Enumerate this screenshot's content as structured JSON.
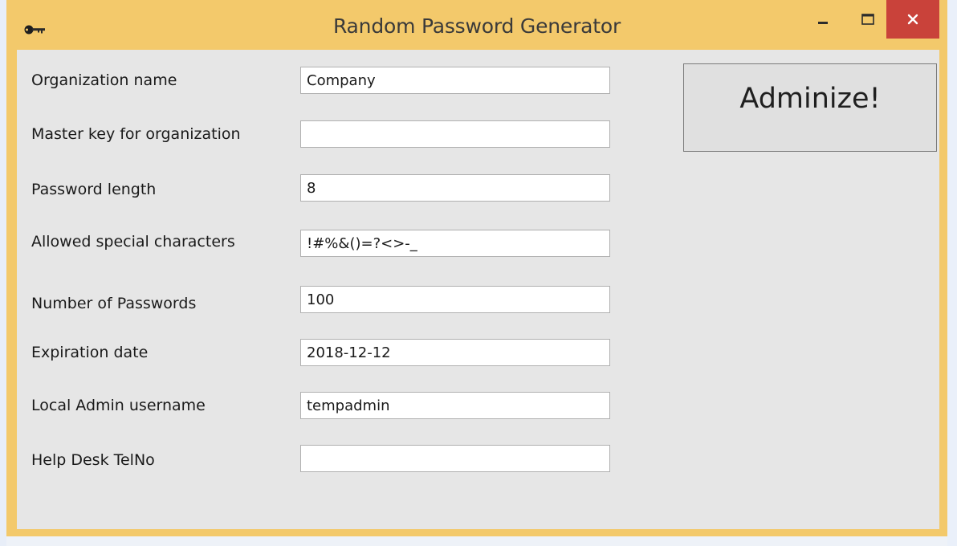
{
  "window": {
    "title": "Random Password Generator"
  },
  "form": {
    "fields": [
      {
        "label": "Organization name",
        "value": ""
      },
      {
        "label": "Master key for organization",
        "value": ""
      },
      {
        "label": "Password length",
        "value": "8"
      },
      {
        "label": "Allowed special characters",
        "value": "!#%&()=?<>-_"
      },
      {
        "label": "Number of Passwords",
        "value": "100"
      },
      {
        "label": "Expiration date",
        "value": "2018-12-12"
      },
      {
        "label": "Local Admin username",
        "value": "tempadmin"
      },
      {
        "label": "Help Desk TelNo",
        "value": ""
      }
    ],
    "organization_value": "Company"
  },
  "actions": {
    "adminize_label": "Adminize!"
  },
  "icons": {
    "app": "key-icon",
    "minimize": "minimize-icon",
    "maximize": "maximize-icon",
    "close": "close-icon"
  },
  "colors": {
    "titlebar": "#f3c96b",
    "close_button": "#c9423a",
    "client_background": "#e6e6e6"
  }
}
